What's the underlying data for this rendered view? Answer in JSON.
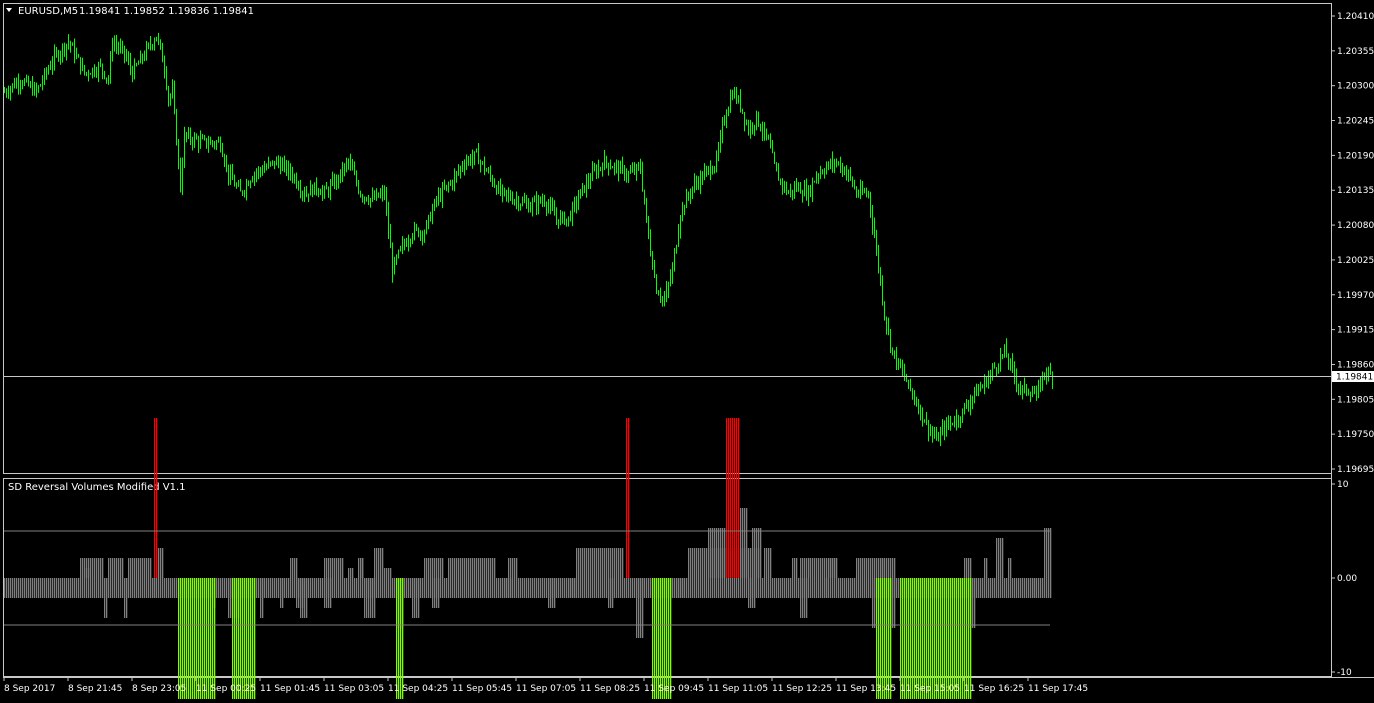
{
  "header": {
    "symbol_label": "EURUSD,M5",
    "ohlc": "1.19841 1.19852 1.19836 1.19841",
    "indicator_title": "SD Reversal Volumes Modified V1.1"
  },
  "colors": {
    "background": "#000000",
    "frame": "#c8c8c8",
    "candle": "#00ff00",
    "bar_neutral": "#808080",
    "bar_buy": "#7fff00",
    "bar_sell": "#ff0000",
    "level_line": "#808080",
    "price_label_bg": "#ffffff",
    "price_label_text": "#000000"
  },
  "chart_data": [
    {
      "type": "candlestick",
      "name_shown": "EURUSD,M5",
      "y_ticks": [
        1.2041,
        1.20355,
        1.203,
        1.20245,
        1.2019,
        1.20135,
        1.2008,
        1.20025,
        1.1997,
        1.19915,
        1.1986,
        1.19805,
        1.1975,
        1.19695
      ],
      "y_tick_labels": [
        "1.20410",
        "1.20355",
        "1.20300",
        "1.20245",
        "1.20190",
        "1.20135",
        "1.20080",
        "1.20025",
        "1.19970",
        "1.19915",
        "1.19860",
        "1.19805",
        "1.19750",
        "1.19695"
      ],
      "current_price": 1.19841,
      "current_price_label": "1.19841",
      "x_tick_labels": [
        "8 Sep 2017",
        "8 Sep 21:45",
        "8 Sep 23:05",
        "11 Sep 00:25",
        "11 Sep 01:45",
        "11 Sep 03:05",
        "11 Sep 04:25",
        "11 Sep 05:45",
        "11 Sep 07:05",
        "11 Sep 08:25",
        "11 Sep 09:45",
        "11 Sep 11:05",
        "11 Sep 12:25",
        "11 Sep 13:45",
        "11 Sep 15:05",
        "11 Sep 16:25",
        "11 Sep 17:45"
      ],
      "close_path": [
        [
          0,
          1.2029
        ],
        [
          8,
          1.2031
        ],
        [
          16,
          1.2029
        ],
        [
          24,
          1.2034
        ],
        [
          32,
          1.2037
        ],
        [
          40,
          1.2032
        ],
        [
          48,
          1.2033
        ],
        [
          52,
          1.2031
        ],
        [
          54,
          1.2037
        ],
        [
          60,
          1.2035
        ],
        [
          64,
          1.2032
        ],
        [
          72,
          1.2036
        ],
        [
          76,
          1.2038
        ],
        [
          80,
          1.2033
        ],
        [
          82,
          1.2028
        ],
        [
          84,
          1.2029
        ],
        [
          88,
          1.2014
        ],
        [
          90,
          1.2022
        ],
        [
          100,
          1.2021
        ],
        [
          108,
          1.2021
        ],
        [
          112,
          1.2016
        ],
        [
          118,
          1.2013
        ],
        [
          124,
          1.2016
        ],
        [
          130,
          1.2017
        ],
        [
          136,
          1.2018
        ],
        [
          144,
          1.2016
        ],
        [
          150,
          1.2013
        ],
        [
          156,
          1.2014
        ],
        [
          160,
          1.2013
        ],
        [
          166,
          1.2015
        ],
        [
          172,
          1.2018
        ],
        [
          178,
          1.2013
        ],
        [
          184,
          1.2012
        ],
        [
          190,
          1.2013
        ],
        [
          194,
          1.2001
        ],
        [
          198,
          1.2004
        ],
        [
          204,
          1.2007
        ],
        [
          210,
          1.2007
        ],
        [
          216,
          1.2012
        ],
        [
          224,
          1.2015
        ],
        [
          230,
          1.2018
        ],
        [
          236,
          1.2019
        ],
        [
          242,
          1.2016
        ],
        [
          248,
          1.2013
        ],
        [
          256,
          1.2012
        ],
        [
          262,
          1.2011
        ],
        [
          270,
          1.2012
        ],
        [
          276,
          1.2009
        ],
        [
          282,
          1.2009
        ],
        [
          288,
          1.2013
        ],
        [
          294,
          1.2016
        ],
        [
          300,
          1.2018
        ],
        [
          306,
          1.2017
        ],
        [
          312,
          1.2016
        ],
        [
          318,
          1.2017
        ],
        [
          322,
          1.2006
        ],
        [
          326,
          1.1998
        ],
        [
          330,
          1.1996
        ],
        [
          334,
          1.2001
        ],
        [
          338,
          1.201
        ],
        [
          344,
          1.2014
        ],
        [
          350,
          1.2016
        ],
        [
          356,
          1.2018
        ],
        [
          360,
          1.2025
        ],
        [
          364,
          1.2029
        ],
        [
          368,
          1.2027
        ],
        [
          372,
          1.2023
        ],
        [
          376,
          1.2025
        ],
        [
          382,
          1.2021
        ],
        [
          386,
          1.2016
        ],
        [
          392,
          1.2013
        ],
        [
          396,
          1.2014
        ],
        [
          402,
          1.2013
        ],
        [
          406,
          1.2016
        ],
        [
          410,
          1.2017
        ],
        [
          416,
          1.2018
        ],
        [
          422,
          1.2016
        ],
        [
          426,
          1.2013
        ],
        [
          432,
          1.2013
        ],
        [
          436,
          1.2004
        ],
        [
          440,
          1.1994
        ],
        [
          444,
          1.1988
        ],
        [
          450,
          1.1984
        ],
        [
          456,
          1.198
        ],
        [
          462,
          1.1976
        ],
        [
          466,
          1.1974
        ],
        [
          470,
          1.1976
        ],
        [
          474,
          1.1977
        ],
        [
          478,
          1.1978
        ],
        [
          484,
          1.1981
        ],
        [
          490,
          1.1983
        ],
        [
          496,
          1.1986
        ],
        [
          500,
          1.1988
        ],
        [
          504,
          1.1985
        ],
        [
          508,
          1.1982
        ],
        [
          512,
          1.1982
        ],
        [
          516,
          1.1981
        ],
        [
          520,
          1.1985
        ],
        [
          524,
          1.1984
        ]
      ]
    },
    {
      "type": "bar",
      "name_shown": "SD Reversal Volumes Modified V1.1",
      "y_ticks": [
        10,
        0,
        -10
      ],
      "y_tick_labels": [
        "10",
        "0.00",
        "-10"
      ],
      "y_range": [
        -10,
        10
      ],
      "levels": [
        5,
        -5
      ],
      "neutral_bars": [
        [
          0,
          524,
          -2
        ],
        [
          38,
          50,
          2
        ],
        [
          52,
          60,
          2
        ],
        [
          62,
          74,
          2
        ],
        [
          76,
          80,
          3
        ],
        [
          160,
          170,
          2
        ],
        [
          172,
          175,
          1
        ],
        [
          177,
          180,
          2
        ],
        [
          190,
          194,
          1
        ],
        [
          210,
          220,
          2
        ],
        [
          222,
          246,
          2
        ],
        [
          252,
          257,
          2
        ],
        [
          286,
          310,
          3
        ],
        [
          342,
          360,
          3
        ],
        [
          360,
          378,
          3
        ],
        [
          394,
          397,
          2
        ],
        [
          402,
          417,
          2
        ],
        [
          426,
          446,
          2
        ],
        [
          480,
          484,
          2
        ],
        [
          490,
          492,
          2
        ],
        [
          502,
          504,
          2
        ]
      ],
      "negative_detail_bars": [
        [
          50,
          52,
          -4
        ],
        [
          60,
          62,
          -4
        ],
        [
          74,
          76,
          -2
        ],
        [
          104,
          106,
          -3
        ],
        [
          112,
          118,
          -4
        ],
        [
          128,
          130,
          -4
        ],
        [
          138,
          140,
          -3
        ],
        [
          146,
          150,
          -3
        ],
        [
          148,
          152,
          -4
        ],
        [
          160,
          164,
          -3
        ],
        [
          180,
          186,
          -4
        ],
        [
          196,
          200,
          -5
        ],
        [
          204,
          208,
          -4
        ],
        [
          214,
          218,
          -3
        ],
        [
          250,
          254,
          -2
        ],
        [
          272,
          276,
          -3
        ],
        [
          282,
          286,
          -2
        ],
        [
          302,
          305,
          -3
        ],
        [
          316,
          320,
          -6
        ],
        [
          336,
          340,
          -2
        ],
        [
          372,
          376,
          -3
        ],
        [
          398,
          402,
          -4
        ],
        [
          410,
          412,
          -2
        ],
        [
          434,
          436,
          -5
        ],
        [
          442,
          446,
          -5
        ],
        [
          482,
          486,
          -5
        ],
        [
          514,
          516,
          -2
        ]
      ],
      "buy_bars": [
        [
          87,
          106,
          -16
        ],
        [
          114,
          126,
          -16
        ],
        [
          196,
          200,
          -16
        ],
        [
          324,
          334,
          -16
        ],
        [
          436,
          444,
          -16
        ],
        [
          448,
          484,
          -16
        ]
      ],
      "sell_bars": [
        [
          75,
          77,
          16
        ],
        [
          311,
          313,
          16
        ],
        [
          361,
          368,
          16
        ]
      ],
      "positive_detail_bars": [
        [
          40,
          43,
          1
        ],
        [
          143,
          147,
          2
        ],
        [
          178,
          180,
          2
        ],
        [
          185,
          190,
          3
        ],
        [
          352,
          361,
          5
        ],
        [
          368,
          372,
          7
        ],
        [
          374,
          379,
          5
        ],
        [
          380,
          384,
          3
        ],
        [
          398,
          403,
          2
        ],
        [
          412,
          416,
          2
        ],
        [
          438,
          440,
          2
        ],
        [
          496,
          500,
          4
        ],
        [
          520,
          524,
          5
        ]
      ]
    }
  ]
}
